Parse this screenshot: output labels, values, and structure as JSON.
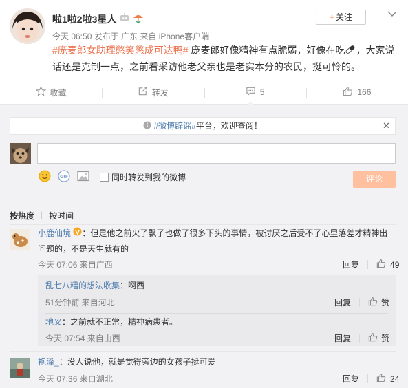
{
  "post": {
    "username": "啦1啦2啦3星人",
    "follow_label": "关注",
    "meta": "今天 06:50 发布于 广东 来自 iPhone客户端",
    "hashtag": "#庞麦郎女助理憋笑憋成可达鸭#",
    "text_part1": " 庞麦郎好像精神有点脆弱，好像在吃",
    "text_part2": "，大家说话还是克制一点，之前看采访他老父亲也是老实本分的农民，挺可怜的。"
  },
  "actions": {
    "favorite_label": "收藏",
    "repost_label": "转发",
    "comment_count": "5",
    "like_count": "166"
  },
  "notice": {
    "prefix": "#微博辟谣#",
    "suffix": "平台，欢迎查阅！"
  },
  "composer": {
    "checkbox_label": "同时转发到我的微博",
    "submit_label": "评论"
  },
  "sort": {
    "hot_label": "按热度",
    "time_label": "按时间"
  },
  "comments": [
    {
      "user": "小鹿仙境",
      "text": "：但是他之前火了飘了也做了很多下头的事情，被讨厌之后受不了心里落差才精神出问题的，不是天生就有的",
      "meta": "今天 07:06 来自广西",
      "reply_label": "回复",
      "likes": "49",
      "replies": [
        {
          "user": "乱七八糟的想法收集",
          "text": "：啊西",
          "meta": "51分钟前 来自河北",
          "reply_label": "回复",
          "like_label": "赞"
        },
        {
          "user": "地叉",
          "text": "：之前就不正常，精神病患者。",
          "meta": "今天 07:54 来自山西",
          "reply_label": "回复",
          "like_label": "赞"
        }
      ]
    },
    {
      "user": "袍泽_",
      "text": "：没人说他，就是觉得旁边的女孩子挺可爱",
      "meta": "今天 07:36 来自湖北",
      "reply_label": "回复",
      "likes": "24"
    }
  ]
}
